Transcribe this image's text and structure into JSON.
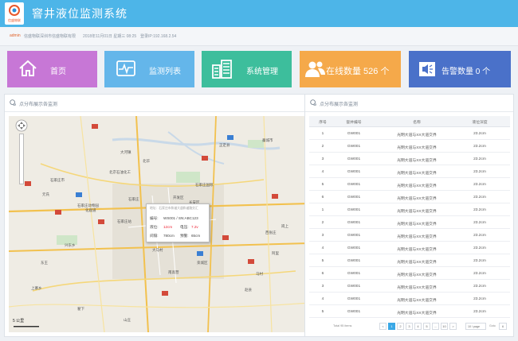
{
  "header": {
    "logo_text": "信盛物联",
    "title": "窨井液位监测系统"
  },
  "infobar": {
    "user": "admin",
    "company": "信盛物联深圳市信盛物联有限",
    "datetime": "2018年11月01日 星期三 08:25",
    "login_ip": "登录IP:192.168.2.54"
  },
  "tiles": [
    {
      "label": "首页",
      "icon": "home-icon",
      "color": "#c777d6"
    },
    {
      "label": "监测列表",
      "icon": "pulse-icon",
      "color": "#64b6ea"
    },
    {
      "label": "系统管理",
      "icon": "building-icon",
      "color": "#3dbe9c"
    },
    {
      "label": "在线数量  526 个",
      "icon": "users-icon",
      "color": "#f5a94a"
    },
    {
      "label": "告警数量  0 个",
      "icon": "speaker-icon",
      "color": "#4a71c9"
    }
  ],
  "map_panel": {
    "title": "点分布展示各监测",
    "scale": "5 公里",
    "labels": [
      "北京石油化工",
      "大河镇",
      "石家庄市",
      "北华",
      "正定县",
      "石家庄国际",
      "开发区",
      "石家庄",
      "藁城市",
      "长安区",
      "化鹿道",
      "石家庄站",
      "石家庄动物园",
      "元氏",
      "栾城区",
      "东王",
      "南高营",
      "赵县",
      "翟下",
      "岗上",
      "阿里",
      "大马村",
      "兴东乡",
      "马村",
      "上寨乡",
      "山庄",
      "西张庄"
    ],
    "popup": {
      "title": "地址：石家庄市和谐大道和谐路交汇",
      "device_label": "编号:",
      "device_value": "WS001 / SN:ABC123",
      "level_label": "液位:",
      "level_value": "12cm",
      "voltage_label": "电压:",
      "voltage_value": "7.2v",
      "interval_label": "间隔:",
      "interval_value": "780cm",
      "alarm_label": "预警:",
      "alarm_value": "65cm"
    }
  },
  "table_panel": {
    "title": "点分布展示各监测",
    "columns": [
      "序号",
      "窨井编号",
      "名称",
      "液位深度"
    ],
    "rows": [
      [
        "1",
        "GW001",
        "光明大道与XX大道交界",
        "23.2cm"
      ],
      [
        "2",
        "GW001",
        "光明大道与XX大道交界",
        "23.2cm"
      ],
      [
        "3",
        "GW001",
        "光明大道与XX大道交界",
        "23.2cm"
      ],
      [
        "4",
        "GW001",
        "光明大道与XX大道交界",
        "23.2cm"
      ],
      [
        "5",
        "GW001",
        "光明大道与XX大道交界",
        "23.2cm"
      ],
      [
        "6",
        "GW001",
        "光明大道与XX大道交界",
        "23.2cm"
      ],
      [
        "1",
        "GW001",
        "光明大道与XX大道交界",
        "23.2cm"
      ],
      [
        "2",
        "GW001",
        "光明大道与XX大道交界",
        "23.2cm"
      ],
      [
        "3",
        "GW001",
        "光明大道与XX大道交界",
        "23.2cm"
      ],
      [
        "4",
        "GW001",
        "光明大道与XX大道交界",
        "23.2cm"
      ],
      [
        "5",
        "GW001",
        "光明大道与XX大道交界",
        "23.2cm"
      ],
      [
        "6",
        "GW001",
        "光明大道与XX大道交界",
        "23.2cm"
      ],
      [
        "3",
        "GW001",
        "光明大道与XX大道交界",
        "23.2cm"
      ],
      [
        "4",
        "GW001",
        "光明大道与XX大道交界",
        "23.2cm"
      ],
      [
        "5",
        "GW001",
        "光明大道与XX大道交界",
        "23.2cm"
      ]
    ],
    "pagination": {
      "total": "Total 95 items",
      "pages": [
        "<",
        "1",
        "2",
        "3",
        "4",
        "5",
        "...",
        "10",
        ">"
      ],
      "active_page": "1",
      "page_size": "10 / page",
      "goto_label": "Goto",
      "goto_value": "6"
    }
  }
}
